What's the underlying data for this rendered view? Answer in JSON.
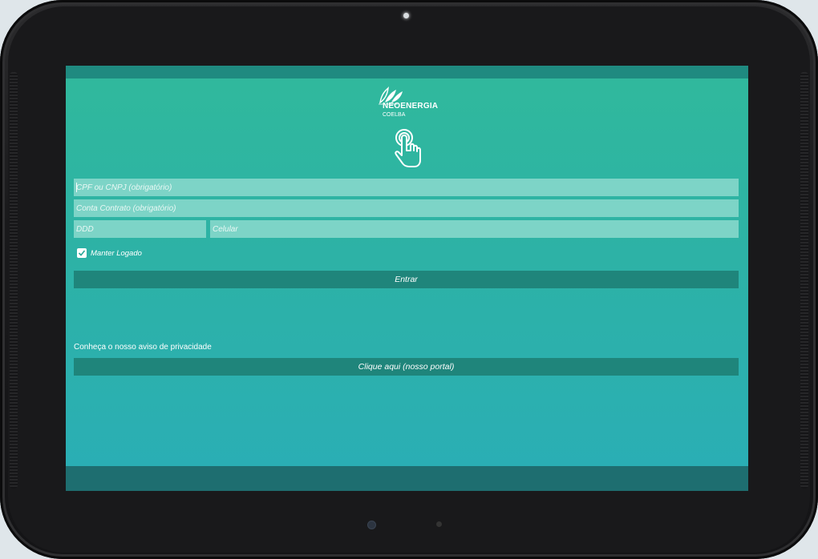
{
  "app": {
    "logo_name": "NEOENERGIA",
    "logo_subtitle": "COELBA"
  },
  "form": {
    "cpf_placeholder": "CPF ou CNPJ (obrigatório)",
    "conta_placeholder": "Conta Contrato (obrigatório)",
    "ddd_placeholder": "DDD",
    "celular_placeholder": "Celular",
    "keep_logged_label": "Manter Logado",
    "keep_logged_checked": true,
    "submit_label": "Entrar"
  },
  "privacy": {
    "text": "Conheça o nosso aviso de privacidade",
    "portal_button_label": "Clique aqui (nosso portal)"
  },
  "icons": {
    "logo": "neoenergia-leaf-logo-icon",
    "touch": "touch-hand-icon",
    "check": "check-icon"
  },
  "colors": {
    "screen_top": "#30b99c",
    "screen_bottom": "#2aaeb6",
    "field_bg": "#7dd4c7",
    "button_bg": "#1f857b",
    "status_bar": "#1f8a80",
    "nav_bar": "#1e6e70"
  }
}
